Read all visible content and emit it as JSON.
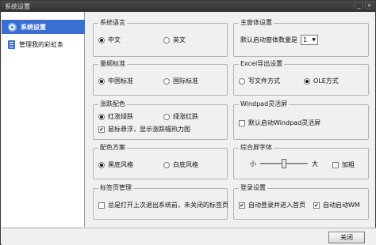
{
  "window": {
    "title": "系统设置",
    "controls": [
      "_",
      "×"
    ]
  },
  "sidebar": {
    "items": [
      {
        "label": "系统设置",
        "active": true
      },
      {
        "label": "管理我的彩虹条",
        "active": false
      }
    ]
  },
  "groups": {
    "language": {
      "title": "系统语言",
      "options": [
        "中文",
        "英文"
      ],
      "selected": "中文"
    },
    "main_window": {
      "title": "主窗体设置",
      "label": "默认启动窗体数量是",
      "value": "1"
    },
    "quote_standard": {
      "title": "量纲标准",
      "options": [
        "中国标准",
        "国际标准"
      ],
      "selected": "中国标准"
    },
    "excel_export": {
      "title": "Excel导出设置",
      "options": [
        "写文件方式",
        "OLE方式"
      ],
      "selected": "OLE方式"
    },
    "color_scheme": {
      "title": "涨跌配色",
      "options": [
        "红涨绿跌",
        "绿涨红跌"
      ],
      "selected": "红涨绿跌",
      "checkbox": {
        "label": "鼠标悬浮，显示涨跌幅热力图",
        "checked": true
      }
    },
    "windpad": {
      "title": "Windpad灵活屏",
      "checkbox": {
        "label": "默认启动Windpad灵活屏",
        "checked": false
      }
    },
    "palette": {
      "title": "配色方案",
      "options": [
        "黑底风格",
        "白底风格"
      ],
      "selected": "黑底风格"
    },
    "font": {
      "title": "综合屏字体",
      "small_label": "小",
      "large_label": "大",
      "bold_label": "加粗",
      "bold_checked": false,
      "level": 0.5
    },
    "tabs": {
      "title": "标签页管理",
      "checkbox": {
        "label": "总是打开上次退出系统前，未关闭的标签页",
        "checked": false
      }
    },
    "login": {
      "title": "登录设置",
      "checkboxes": [
        {
          "label": "自动登录并进入首页",
          "checked": true
        },
        {
          "label": "自动启动WM",
          "checked": true
        }
      ]
    }
  },
  "footer": {
    "close_label": "关闭"
  }
}
